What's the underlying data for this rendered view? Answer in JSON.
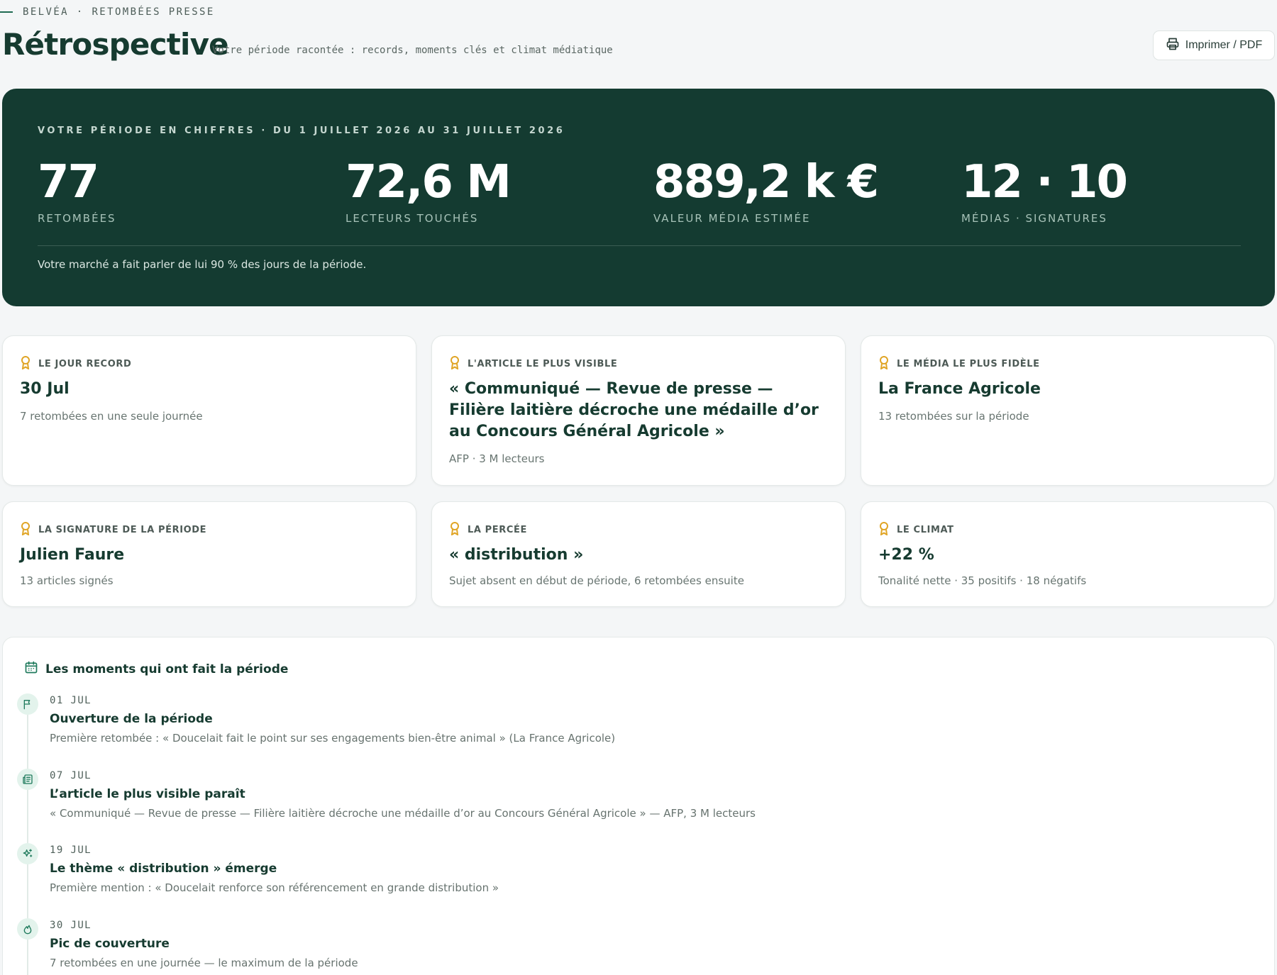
{
  "header": {
    "eyebrow": "BELVÉA · RETOMBÉES PRESSE",
    "title": "Rétrospective",
    "subtitle": "Votre période racontée : records, moments clés et climat médiatique",
    "print_label": "Imprimer / PDF"
  },
  "hero": {
    "eyebrow": "VOTRE PÉRIODE EN CHIFFRES · DU 1 JUILLET 2026 AU 31 JUILLET 2026",
    "stats": [
      {
        "value": "77",
        "label": "RETOMBÉES"
      },
      {
        "value": "72,6 M",
        "label": "LECTEURS TOUCHÉS"
      },
      {
        "value": "889,2 k €",
        "label": "VALEUR MÉDIA ESTIMÉE"
      },
      {
        "value": "12 · 10",
        "label": "MÉDIAS · SIGNATURES"
      }
    ],
    "note": "Votre marché a fait parler de lui 90 % des jours de la période."
  },
  "cards": [
    {
      "label": "LE JOUR RECORD",
      "value": "30 Jul",
      "sub": "7 retombées en une seule journée"
    },
    {
      "label": "L'ARTICLE LE PLUS VISIBLE",
      "value": "« Communiqué — Revue de presse — Filière laitière décroche une médaille d’or au Concours Général Agricole »",
      "sub": "AFP · 3 M lecteurs"
    },
    {
      "label": "LE MÉDIA LE PLUS FIDÈLE",
      "value": "La France Agricole",
      "sub": "13 retombées sur la période"
    },
    {
      "label": "LA SIGNATURE DE LA PÉRIODE",
      "value": "Julien Faure",
      "sub": "13 articles signés"
    },
    {
      "label": "LA PERCÉE",
      "value": "« distribution »",
      "sub": "Sujet absent en début de période, 6 retombées ensuite"
    },
    {
      "label": "LE CLIMAT",
      "value": "+22 %",
      "sub": "Tonalité nette · 35 positifs · 18 négatifs"
    }
  ],
  "moments": {
    "title": "Les moments qui ont fait la période",
    "items": [
      {
        "icon": "flag-icon",
        "date": "01 JUL",
        "title": "Ouverture de la période",
        "desc": "Première retombée : « Doucelait fait le point sur ses engagements bien-être animal » (La France Agricole)"
      },
      {
        "icon": "newspaper-icon",
        "date": "07 JUL",
        "title": "L’article le plus visible paraît",
        "desc": "« Communiqué — Revue de presse — Filière laitière décroche une médaille d’or au Concours Général Agricole » — AFP, 3 M lecteurs"
      },
      {
        "icon": "sparkles-icon",
        "date": "19 JUL",
        "title": "Le thème « distribution » émerge",
        "desc": "Première mention : « Doucelait renforce son référencement en grande distribution »"
      },
      {
        "icon": "flame-icon",
        "date": "30 JUL",
        "title": "Pic de couverture",
        "desc": "7 retombées en une journée — le maximum de la période"
      }
    ]
  },
  "colors": {
    "accent": "#143b31",
    "award": "#e0a526",
    "timeline_icon_bg": "#e3f3ec"
  }
}
